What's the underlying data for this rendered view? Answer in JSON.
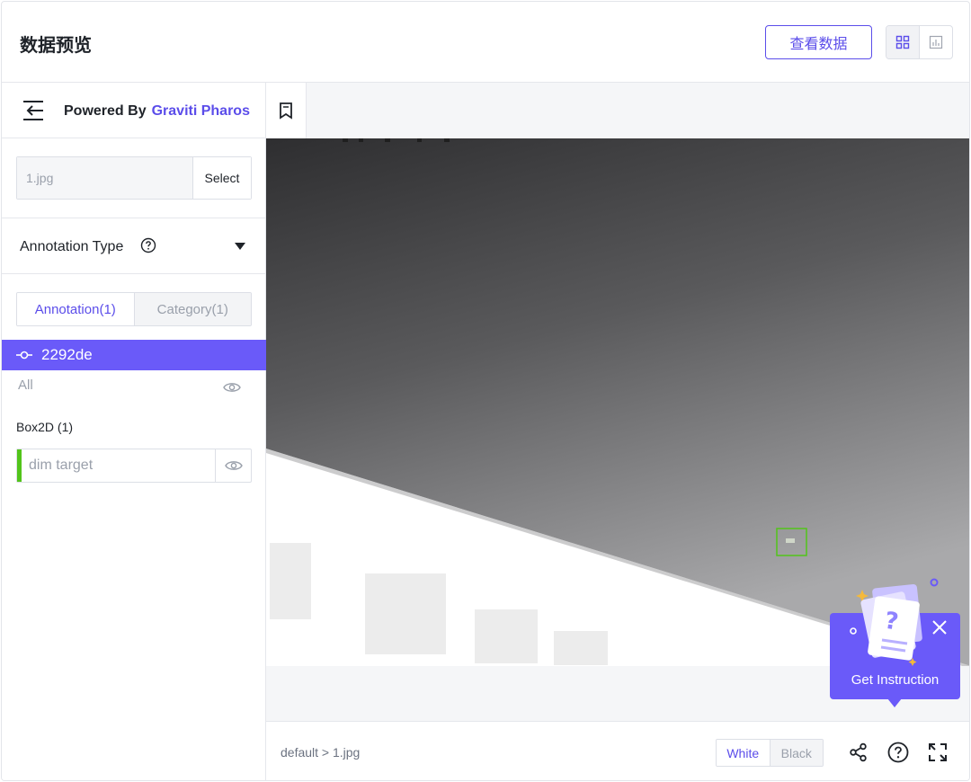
{
  "header": {
    "title": "数据预览",
    "view_data_button": "查看数据",
    "view_modes": [
      "grid-view-icon",
      "chart-view-icon"
    ]
  },
  "sidebar": {
    "powered_by": "Powered By",
    "brand": "Graviti Pharos",
    "file": {
      "placeholder": "1.jpg",
      "select_label": "Select"
    },
    "annotation_type_label": "Annotation Type",
    "tabs": [
      {
        "label": "Annotation(1)",
        "active": true
      },
      {
        "label": "Category(1)",
        "active": false
      }
    ],
    "annotation_item": "2292de",
    "all_label": "All",
    "group_label": "Box2D (1)",
    "labels": [
      {
        "name": "dim target",
        "color": "#52c41a"
      }
    ]
  },
  "footer": {
    "breadcrumb": "default > 1.jpg",
    "background_options": [
      {
        "label": "White",
        "active": true
      },
      {
        "label": "Black",
        "active": false
      }
    ],
    "icons": [
      "share-icon",
      "help-icon",
      "fullscreen-icon"
    ]
  },
  "instruction": {
    "label": "Get Instruction"
  },
  "colors": {
    "accent": "#5b4dea",
    "selected_item": "#6a5af9",
    "box_annotation": "#52c41a"
  }
}
